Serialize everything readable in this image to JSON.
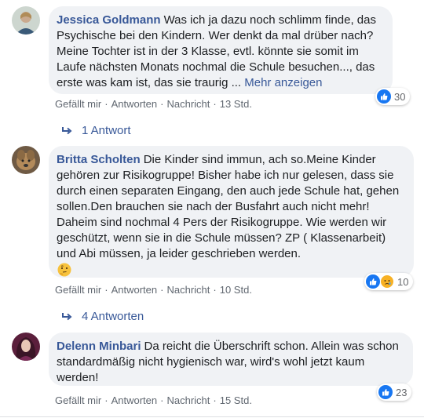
{
  "comments": [
    {
      "author": "Jessica Goldmann",
      "text": "Was ich ja dazu noch schlimm finde, das Psychische bei den Kindern. Wer denkt da mal drüber nach? Meine Tochter ist in der 3 Klasse, evtl. könnte sie somit im Laufe nächsten Monats nochmal die Schule besuchen..., das erste was kam ist, das sie traurig ...",
      "more": "Mehr anzeigen",
      "reaction_count": "30",
      "like": "Gefällt mir",
      "reply": "Antworten",
      "message": "Nachricht",
      "time": "13 Std.",
      "replies": "1 Antwort"
    },
    {
      "author": "Britta Scholten",
      "text": "Die Kinder sind immun, ach so.Meine Kinder gehören zur Risikogruppe! Bisher habe ich nur gelesen, dass sie durch einen separaten Eingang, den auch jede Schule hat, gehen sollen.Den brauchen sie nach der Busfahrt auch nicht mehr! Daheim sind nochmal 4 Pers der Risikogruppe. Wie werden wir geschützt, wenn sie in die Schule müssen? ZP ( Klassenarbeit) und Abi müssen, ja leider geschrieben werden.",
      "reaction_count": "10",
      "like": "Gefällt mir",
      "reply": "Antworten",
      "message": "Nachricht",
      "time": "10 Std.",
      "replies": "4 Antworten"
    },
    {
      "author": "Delenn Minbari",
      "text": "Da reicht die Überschrift schon. Allein was schon standardmäßig nicht hygienisch war, wird's wohl jetzt kaum werden!",
      "reaction_count": "23",
      "like": "Gefällt mir",
      "reply": "Antworten",
      "message": "Nachricht",
      "time": "15 Std."
    }
  ],
  "separator": "·",
  "colors": {
    "link": "#385898",
    "bubble": "#f0f2f5",
    "like": "#1877f2",
    "meta": "#606770"
  }
}
